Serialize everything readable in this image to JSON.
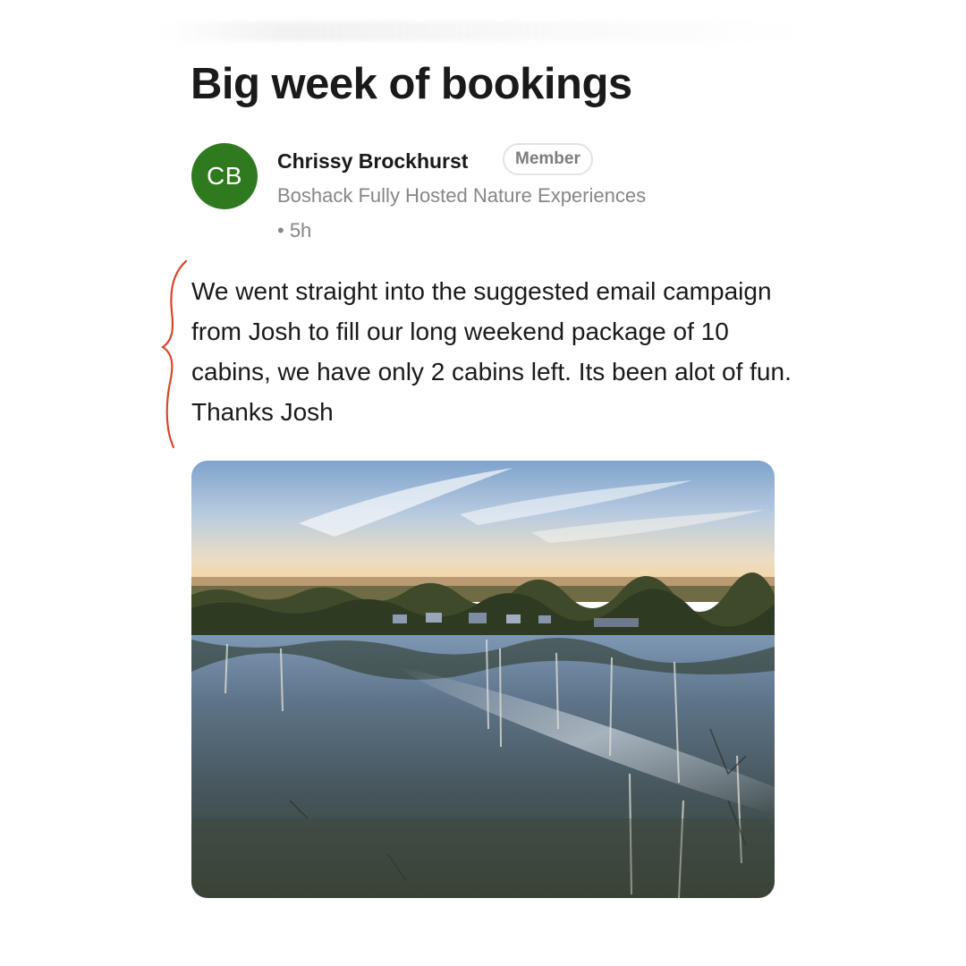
{
  "post": {
    "title": "Big week of bookings",
    "author": {
      "initials": "CB",
      "name": "Chrissy Brockhurst",
      "role": "Member",
      "organization": "Boshack Fully Hosted Nature Experiences",
      "time": "• 5h",
      "avatar_color": "#2f7a1f"
    },
    "body": "We went straight into the suggested email campaign from Josh to fill our long weekend package of 10 cabins, we have only 2 cabins left. Its been alot of fun. Thanks Josh",
    "image": {
      "kind": "photo",
      "subject": "lake-reflection-landscape"
    }
  },
  "annotation": {
    "kind": "handwritten-bracket",
    "color": "#d9452a"
  }
}
